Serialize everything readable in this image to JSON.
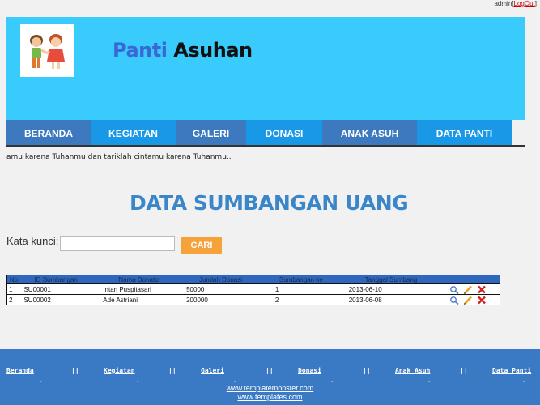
{
  "top": {
    "user": "admin",
    "bracket_open": "[",
    "logout": "LogOut",
    "bracket_close": "]"
  },
  "header": {
    "title_part1": "Panti",
    "title_part2": "Asuhan",
    "bg_color": "#38cbfb"
  },
  "nav": {
    "items": [
      {
        "label": "BERANDA"
      },
      {
        "label": "KEGIATAN"
      },
      {
        "label": "GALERI"
      },
      {
        "label": "DONASI"
      },
      {
        "label": "ANAK ASUH"
      },
      {
        "label": "DATA PANTI"
      }
    ]
  },
  "marquee": "amu karena Tuhanmu dan tariklah cintamu karena Tuhanmu..",
  "page_title": "DATA SUMBANGAN UANG",
  "search": {
    "label": "Kata kunci:",
    "value": "",
    "placeholder": "",
    "button": "CARI"
  },
  "table": {
    "headers": [
      "No",
      "ID Sumbangan",
      "Nama Donatur",
      "Jumlah Donasi",
      "Sumbangan ke",
      "Tanggal Sumbang",
      ""
    ],
    "rows": [
      {
        "no": "1",
        "id": "SU00001",
        "nama": "Intan Puspitasari",
        "jumlah": "50000",
        "ke": "1",
        "tanggal": "2013-06-10"
      },
      {
        "no": "2",
        "id": "SU00002",
        "nama": "Ade Astriani",
        "jumlah": "200000",
        "ke": "2",
        "tanggal": "2013-06-08"
      }
    ],
    "row_actions": [
      "view-icon",
      "edit-icon",
      "delete-icon"
    ]
  },
  "footer": {
    "links": [
      {
        "label": "Beranda"
      },
      {
        "label": "Kegiatan"
      },
      {
        "label": "Galeri"
      },
      {
        "label": "Donasi"
      },
      {
        "label": "Anak Asuh"
      },
      {
        "label": "Data Panti"
      }
    ],
    "separator": "||",
    "dot": "-",
    "url1": "www.templatemonster.com",
    "url2": "www.templates.com"
  }
}
